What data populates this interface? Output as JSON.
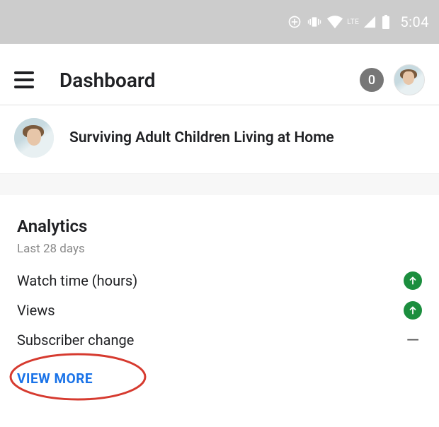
{
  "status": {
    "time": "5:04",
    "lte": "LTE"
  },
  "appbar": {
    "title": "Dashboard",
    "badge": "0"
  },
  "video": {
    "title": "Surviving Adult Children Living at Home"
  },
  "analytics": {
    "heading": "Analytics",
    "subheading": "Last 28 days",
    "metrics": [
      {
        "label": "Watch time (hours)",
        "trend": "up"
      },
      {
        "label": "Views",
        "trend": "up"
      },
      {
        "label": "Subscriber change",
        "trend": "flat"
      }
    ],
    "view_more": "VIEW MORE"
  }
}
